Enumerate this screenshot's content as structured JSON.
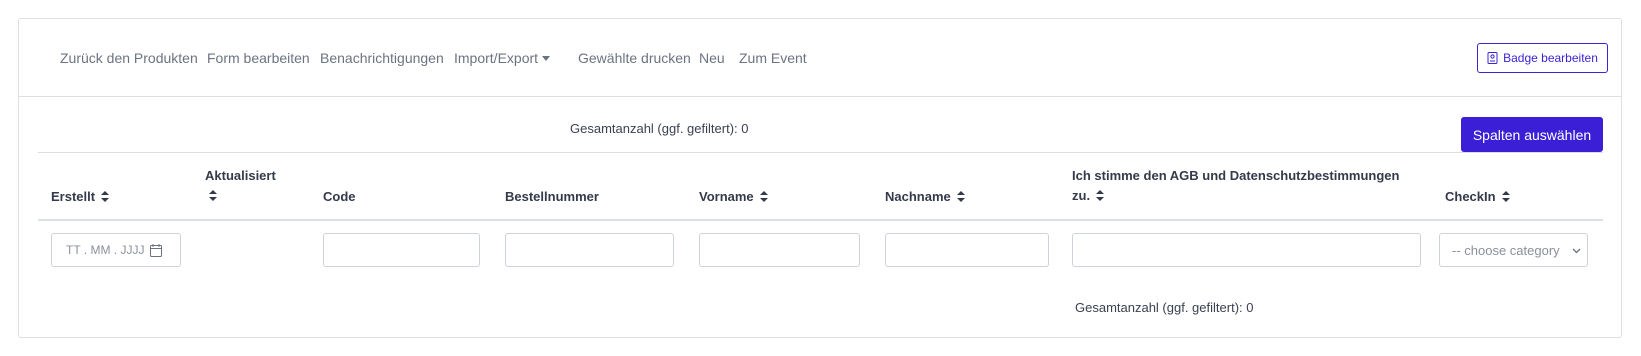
{
  "nav": {
    "back": "Zurück den Produkten",
    "edit_form": "Form bearbeiten",
    "notifications": "Benachrichtigungen",
    "import_export": "Import/Export",
    "print_selected": "Gewählte drucken",
    "new": "Neu",
    "to_event": "Zum Event"
  },
  "badge_button": {
    "label": "Badge bearbeiten",
    "icon": "badge-icon"
  },
  "total_top": "Gesamtanzahl (ggf. gefiltert): 0",
  "columns_button": "Spalten auswählen",
  "table": {
    "headers": {
      "created": "Erstellt",
      "updated": "Aktualisiert",
      "code": "Code",
      "order_number": "Bestellnummer",
      "first_name": "Vorname",
      "last_name": "Nachname",
      "terms_line1": "Ich stimme den AGB und Datenschutzbestimmungen",
      "terms_line2": "zu.",
      "checkin": "CheckIn"
    },
    "filters": {
      "date_placeholder": "TT . MM . JJJJ",
      "select_value": "-- choose category"
    }
  },
  "total_bottom": "Gesamtanzahl (ggf. gefiltert): 0",
  "colors": {
    "accent": "#3b1fd6",
    "border": "#dcdfe4",
    "text": "#3b4151"
  }
}
